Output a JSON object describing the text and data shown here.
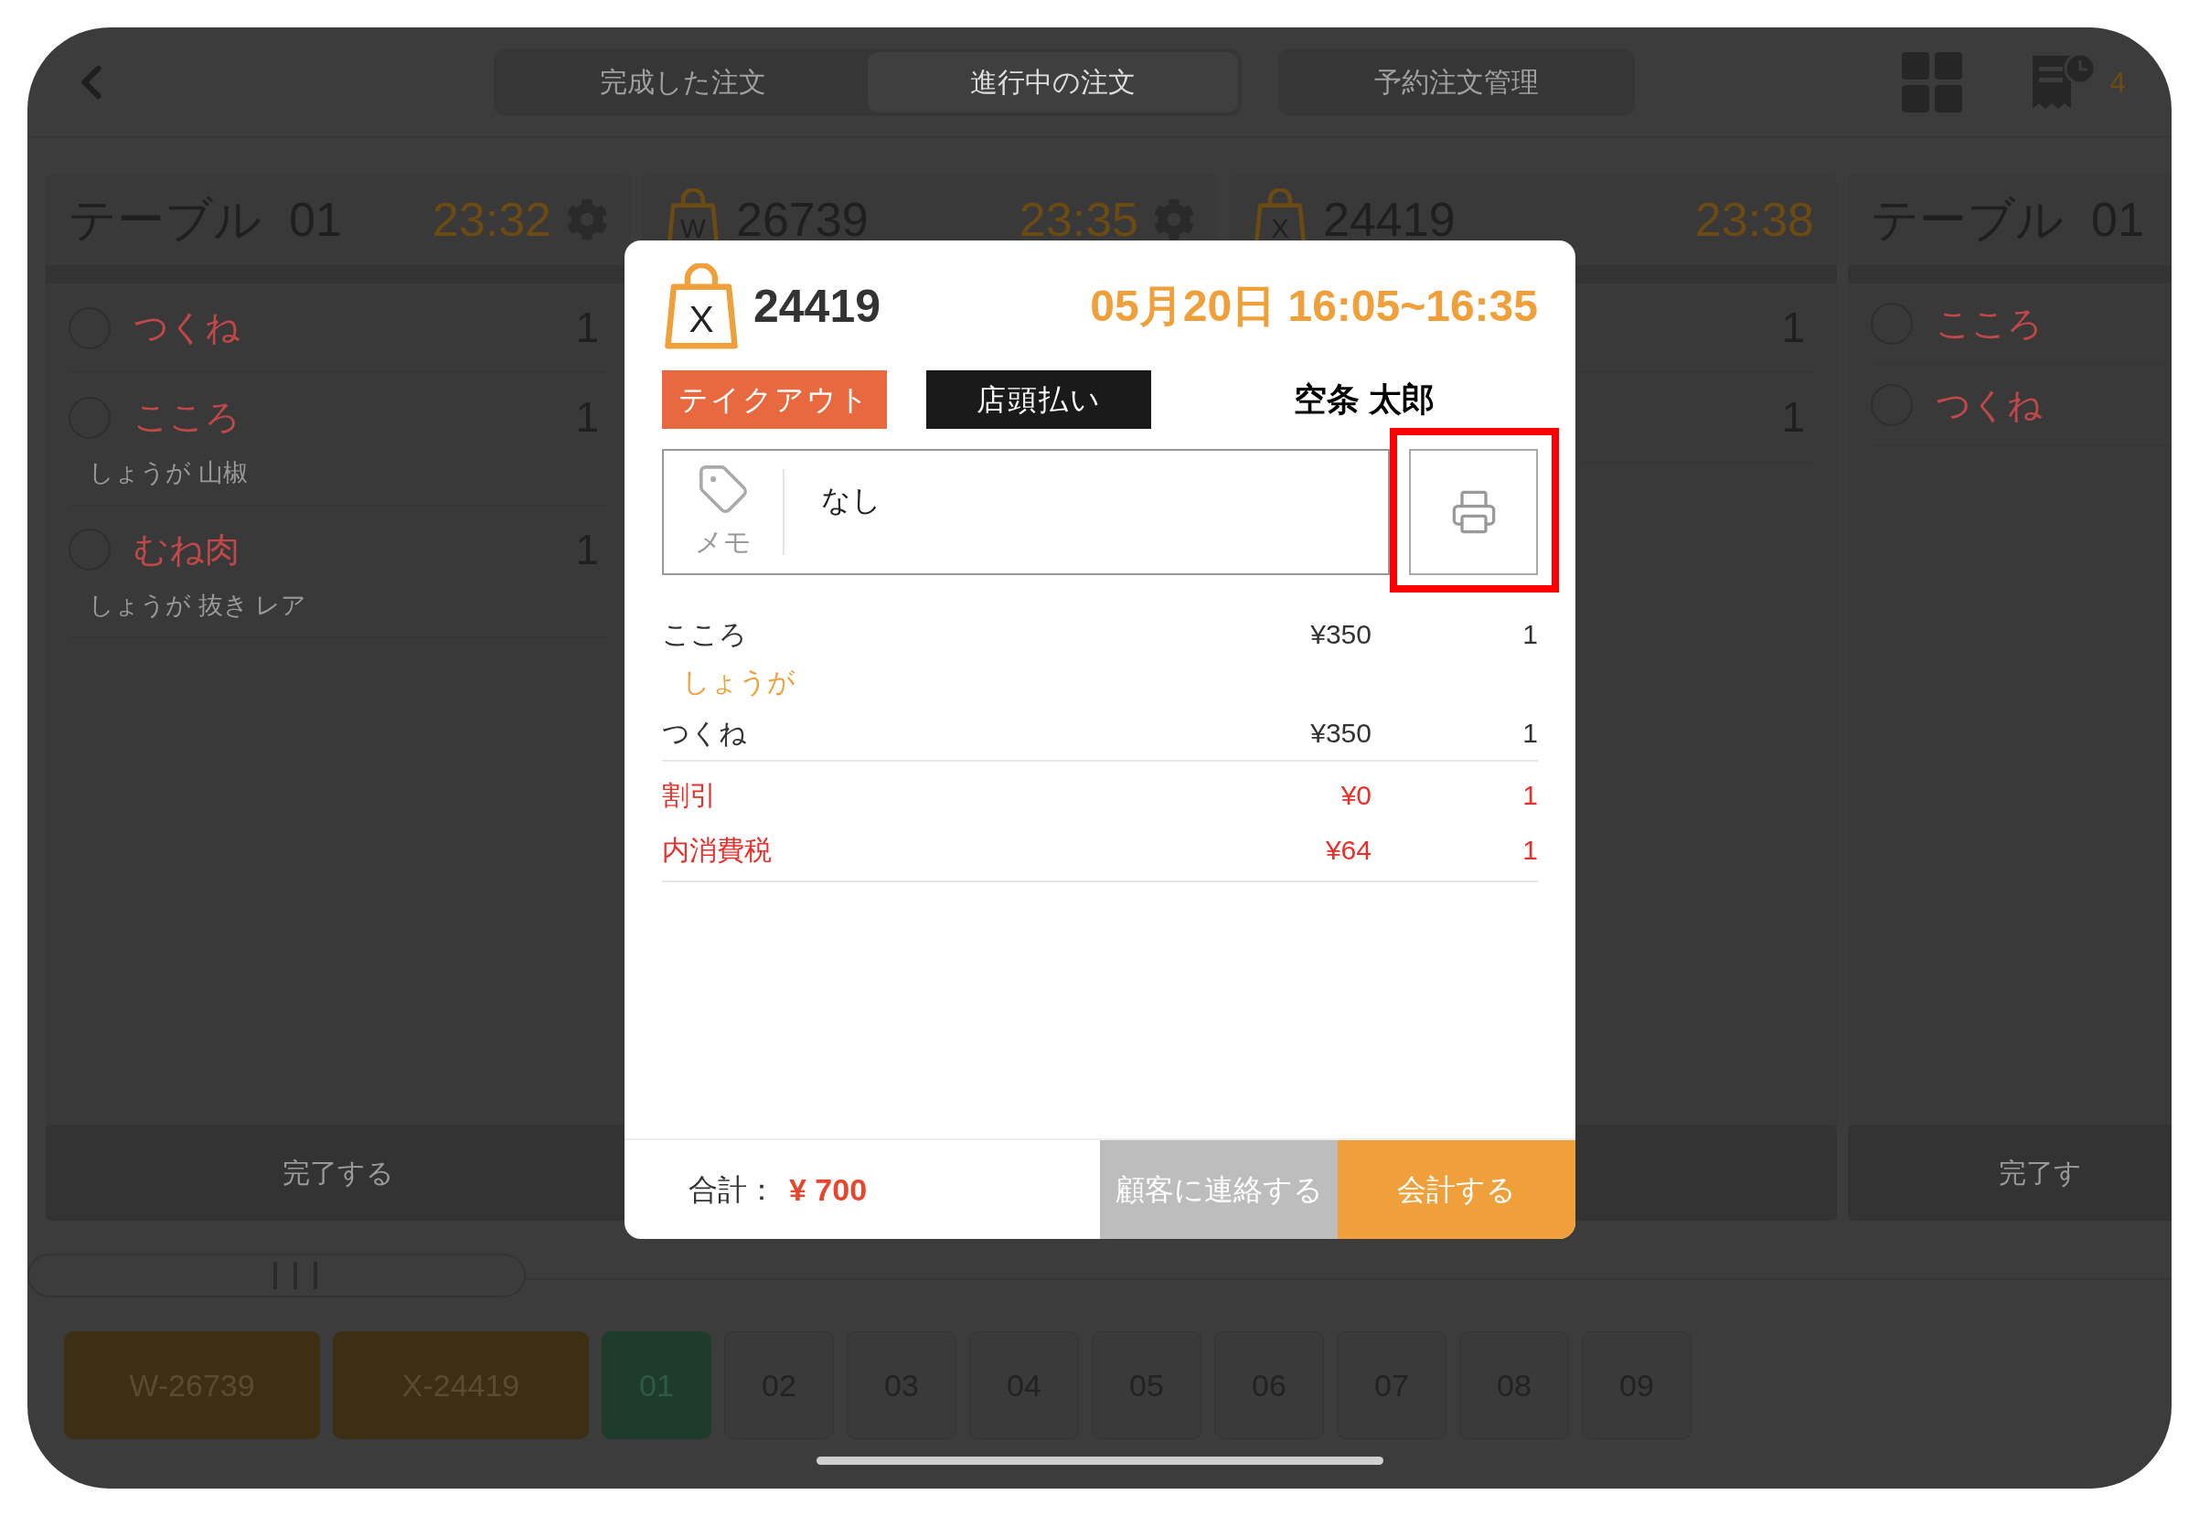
{
  "top_tabs": [
    {
      "label": "完成した注文",
      "selected": false
    },
    {
      "label": "進行中の注文",
      "selected": true
    },
    {
      "label": "予約注文管理",
      "selected": false
    }
  ],
  "reservation_count": "4",
  "orders": [
    {
      "kind": "table",
      "title": "テーブル",
      "number": "01",
      "time": "23:32",
      "settings_icon": true,
      "items": [
        {
          "name": "つくね",
          "qty": "1",
          "checked": false
        },
        {
          "name": "こころ",
          "qty": "1",
          "note": "しょうが 山椒",
          "checked": false
        },
        {
          "name": "むね肉",
          "qty": "1",
          "note": "しょうが 抜き レア",
          "checked": false
        }
      ],
      "footer_label": "完了する"
    },
    {
      "kind": "bag",
      "bag_letter": "W",
      "number": "26739",
      "time": "23:35",
      "settings_icon": true
    },
    {
      "kind": "bag",
      "bag_letter": "X",
      "number": "24419",
      "time": "23:38",
      "settings_icon": false,
      "items": [
        {
          "qty": "1"
        },
        {
          "qty": "1"
        }
      ]
    },
    {
      "kind": "table",
      "title": "テーブル",
      "number": "01",
      "settings_icon": false,
      "items": [
        {
          "name": "こころ",
          "checked": false
        },
        {
          "name": "つくね",
          "checked": false
        }
      ],
      "footer_label": "完了す"
    }
  ],
  "bottom_tabs": [
    {
      "label": "W-26739",
      "kind": "order",
      "selected": false
    },
    {
      "label": "X-24419",
      "kind": "order",
      "selected": false
    },
    {
      "label": "01",
      "kind": "table",
      "selected": true
    },
    {
      "label": "02",
      "kind": "table",
      "selected": false
    },
    {
      "label": "03",
      "kind": "table",
      "selected": false
    },
    {
      "label": "04",
      "kind": "table",
      "selected": false
    },
    {
      "label": "05",
      "kind": "table",
      "selected": false
    },
    {
      "label": "06",
      "kind": "table",
      "selected": false
    },
    {
      "label": "07",
      "kind": "table",
      "selected": false
    },
    {
      "label": "08",
      "kind": "table",
      "selected": false
    },
    {
      "label": "09",
      "kind": "table",
      "selected": false
    }
  ],
  "order_detail": {
    "bag_letter": "X",
    "number": "24419",
    "schedule": "05月20日 16:05~16:35",
    "badges": [
      {
        "label": "テイクアウト",
        "kind": "service"
      },
      {
        "label": "店頭払い",
        "kind": "payment"
      }
    ],
    "customer": "空条 太郎",
    "memo_label": "メモ",
    "memo_text": "なし",
    "print_highlighted": true,
    "lines": [
      {
        "kind": "item",
        "name": "こころ",
        "price": "¥350",
        "qty": "1",
        "note": "しょうが"
      },
      {
        "kind": "item",
        "name": "つくね",
        "price": "¥350",
        "qty": "1"
      },
      {
        "kind": "adjustment",
        "name": "割引",
        "price": "¥0",
        "qty": "1"
      },
      {
        "kind": "adjustment",
        "name": "内消費税",
        "price": "¥64",
        "qty": "1"
      }
    ],
    "total_label": "合計：",
    "total": "¥ 700",
    "buttons": [
      {
        "label": "顧客に連絡する",
        "kind": "secondary"
      },
      {
        "label": "会計する",
        "kind": "primary"
      }
    ]
  }
}
